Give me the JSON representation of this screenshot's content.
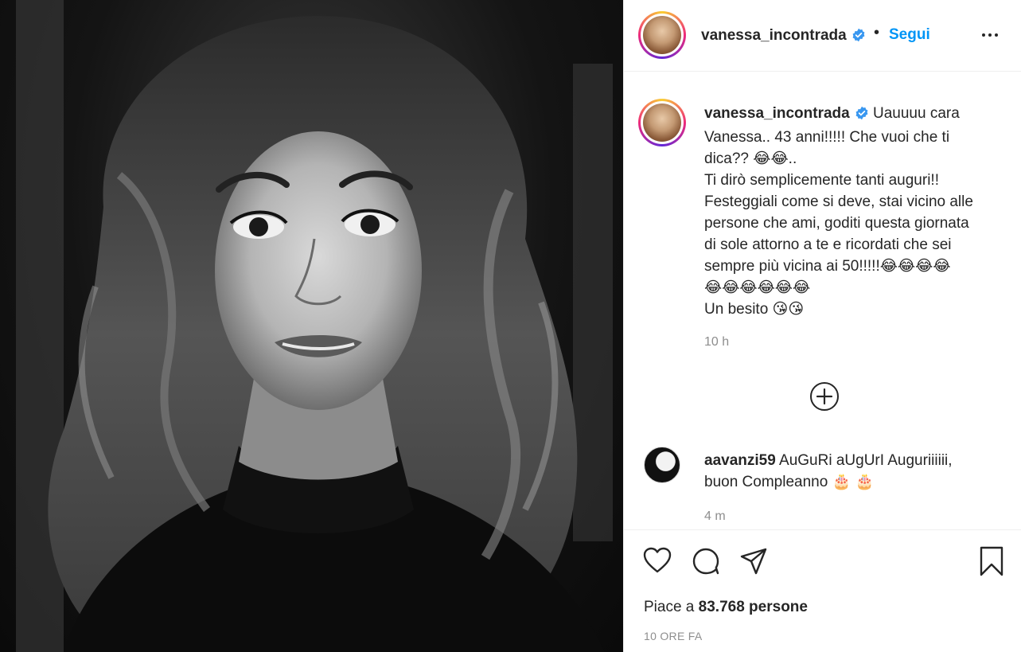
{
  "post": {
    "image_alt": "Black and white selfie portrait",
    "author": "vanessa_incontrada",
    "dot": "•",
    "follow_label": "Segui",
    "more_icon": "ellipsis-icon"
  },
  "caption": {
    "username": "vanessa_incontrada",
    "lines": [
      "Uauuuu cara",
      "Vanessa.. 43 anni!!!!! Che vuoi che ti",
      "dica?? 😂😂..",
      "Ti dirò semplicemente tanti auguri!!",
      "Festeggiali come si deve, stai vicino alle",
      "persone che ami, goditi questa giornata",
      "di sole attorno a te e ricordati che sei",
      "sempre più vicina ai 50!!!!!😂😂😂😂",
      "😂😂😂😂😂😂",
      "Un besito 😘😘"
    ],
    "time": "10 h"
  },
  "load_more_icon": "plus-circle-icon",
  "comment": {
    "username": "aavanzi59",
    "text_line1": "AuGuRi aUgUrI Auguriiiiii,",
    "text_line2": "buon Compleanno 🎂 🎂",
    "time": "4 m"
  },
  "actions": {
    "like_icon": "heart-icon",
    "comment_icon": "comment-icon",
    "share_icon": "paper-plane-icon",
    "save_icon": "bookmark-icon"
  },
  "likes": {
    "prefix": "Piace a ",
    "count": "83.768",
    "suffix": " persone"
  },
  "date": "10 ORE FA",
  "colors": {
    "follow": "#0095f6",
    "secondary_text": "#8e8e8e",
    "verified": "#3897f0",
    "border": "#efefef"
  }
}
